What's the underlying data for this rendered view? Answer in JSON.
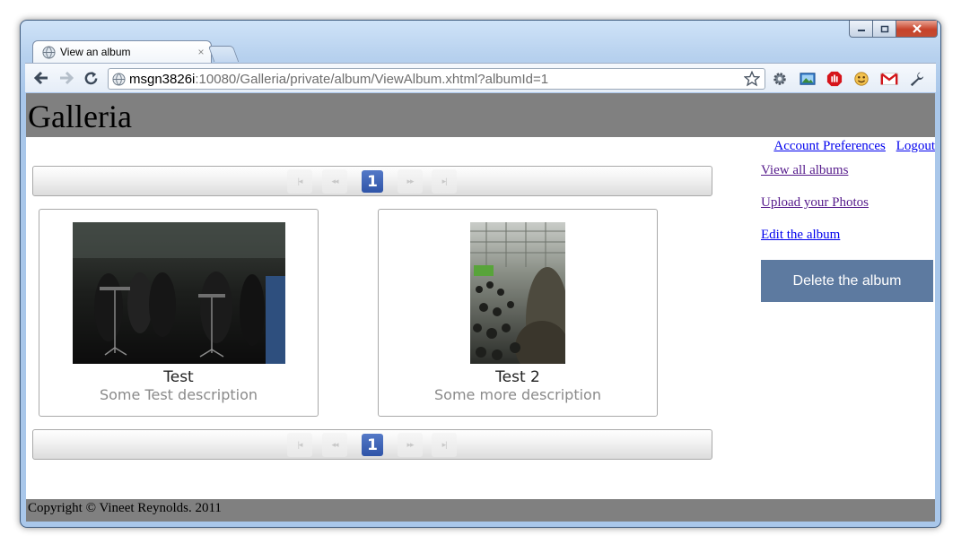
{
  "browser": {
    "tab_title": "View an album",
    "tab_close": "×",
    "url_host": "msgn3826i",
    "url_rest": ":10080/Galleria/private/album/ViewAlbum.xhtml?albumId=1"
  },
  "header": {
    "title": "Galleria"
  },
  "top_links": {
    "account_preferences": "Account Preferences",
    "logout": "Logout"
  },
  "side_links": {
    "view_all_albums": "View all albums",
    "upload_photos": "Upload your Photos",
    "edit_album": "Edit the album"
  },
  "actions": {
    "delete_album": "Delete the album"
  },
  "paginator": {
    "first": "|◂",
    "prev": "◂◂",
    "next": "▸▸",
    "last": "▸|",
    "current_page": "1"
  },
  "photos": [
    {
      "name": "Test",
      "description": "Some Test description"
    },
    {
      "name": "Test 2",
      "description": "Some more description"
    }
  ],
  "footer": {
    "copyright": "Copyright © Vineet Reynolds. 2011"
  },
  "colors": {
    "header_bg": "#808080",
    "delete_button_bg": "#5d7aa0",
    "link": "#0000ee",
    "visited_link": "#551a8b",
    "page_number_bg": "#3a5fb3"
  }
}
